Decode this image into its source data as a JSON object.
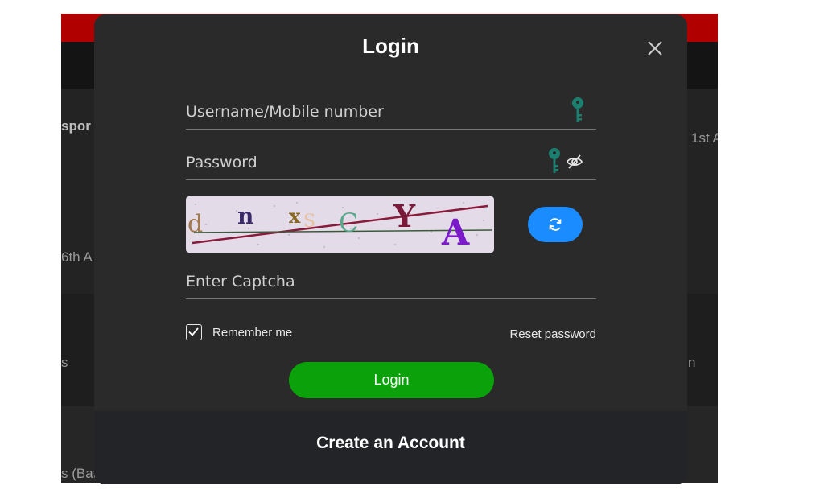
{
  "background": {
    "left_text_1": "spor",
    "left_text_2": "6th A",
    "left_text_3": "s",
    "left_text_4": "s (Bat",
    "right_text_1": "1st A",
    "right_text_2": "n"
  },
  "modal": {
    "title": "Login",
    "close_icon": "close-icon",
    "username": {
      "placeholder": "Username/Mobile number",
      "value": "",
      "icon": "key-icon"
    },
    "password": {
      "placeholder": "Password",
      "value": "",
      "icons": [
        "key-icon",
        "eye-slash-icon"
      ]
    },
    "captcha": {
      "image_text": "dnxSCYA",
      "refresh_icon": "refresh-icon",
      "input_placeholder": "Enter Captcha",
      "value": ""
    },
    "remember_me": {
      "label": "Remember me",
      "checked": true
    },
    "reset_password_label": "Reset password",
    "login_button_label": "Login",
    "create_account_label": "Create an Account"
  },
  "colors": {
    "modal_bg": "#2a2a2a",
    "login_button": "#0aa10a",
    "refresh_button": "#1a8cff",
    "key_icon": "#1a7f6e",
    "top_bar": "#b00000"
  }
}
